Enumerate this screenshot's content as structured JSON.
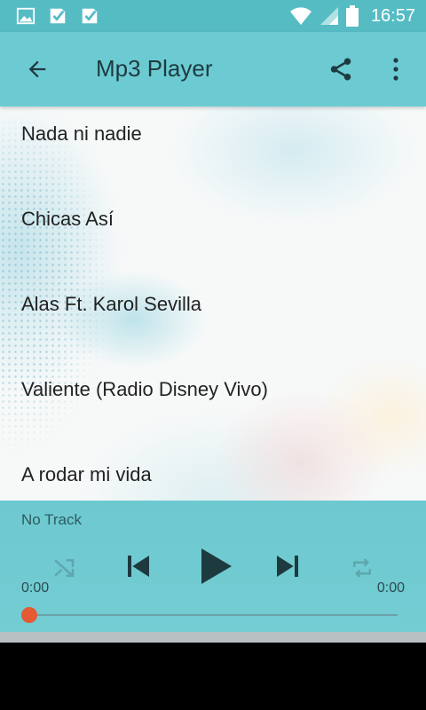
{
  "status_bar": {
    "time": "16:57",
    "icons": [
      "image-icon",
      "checkbox-icon",
      "checkbox-icon",
      "wifi-icon",
      "signal-icon",
      "battery-icon"
    ]
  },
  "toolbar": {
    "title": "Mp3 Player",
    "back_icon": "arrow-back-icon",
    "share_icon": "share-icon",
    "more_icon": "more-vert-icon"
  },
  "tracks": [
    {
      "title": "Nada ni nadie"
    },
    {
      "title": "Chicas Así"
    },
    {
      "title": "Alas Ft. Karol Sevilla"
    },
    {
      "title": "Valiente (Radio Disney Vivo)"
    },
    {
      "title": "A rodar mi vida"
    }
  ],
  "player": {
    "now_playing": "No Track",
    "current_time": "0:00",
    "total_time": "0:00",
    "progress": 0,
    "accent_color": "#e35a35",
    "panel_color": "#6dc9d0"
  },
  "colors": {
    "status_bar": "#56bcc4",
    "toolbar": "#6ccbd2"
  }
}
